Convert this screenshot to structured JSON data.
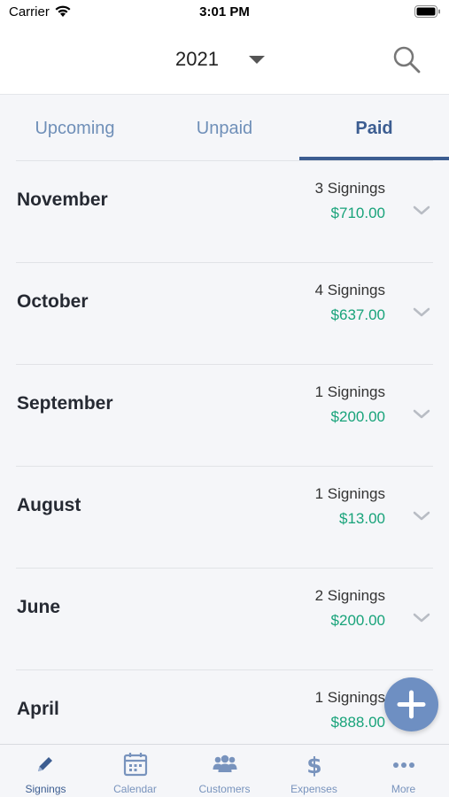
{
  "status_bar": {
    "carrier": "Carrier",
    "time": "3:01 PM"
  },
  "header": {
    "year": "2021",
    "search_icon": "search-icon"
  },
  "tabs": [
    {
      "label": "Upcoming",
      "active": false
    },
    {
      "label": "Unpaid",
      "active": false
    },
    {
      "label": "Paid",
      "active": true
    }
  ],
  "months": [
    {
      "name": "November",
      "count": "3 Signings",
      "amount": "$710.00"
    },
    {
      "name": "October",
      "count": "4 Signings",
      "amount": "$637.00"
    },
    {
      "name": "September",
      "count": "1 Signings",
      "amount": "$200.00"
    },
    {
      "name": "August",
      "count": "1 Signings",
      "amount": "$13.00"
    },
    {
      "name": "June",
      "count": "2 Signings",
      "amount": "$200.00"
    },
    {
      "name": "April",
      "count": "1 Signings",
      "amount": "$888.00"
    }
  ],
  "fab": {
    "icon": "plus-icon"
  },
  "nav": [
    {
      "label": "Signings",
      "icon": "pencil-icon",
      "active": true
    },
    {
      "label": "Calendar",
      "icon": "calendar-icon",
      "active": false
    },
    {
      "label": "Customers",
      "icon": "users-icon",
      "active": false
    },
    {
      "label": "Expenses",
      "icon": "dollar-icon",
      "active": false
    },
    {
      "label": "More",
      "icon": "more-dots-icon",
      "active": false
    }
  ],
  "colors": {
    "accent": "#3c5d91",
    "accent_light": "#6f8fb8",
    "amount_green": "#18a37a",
    "fab": "#6e8fc2"
  }
}
